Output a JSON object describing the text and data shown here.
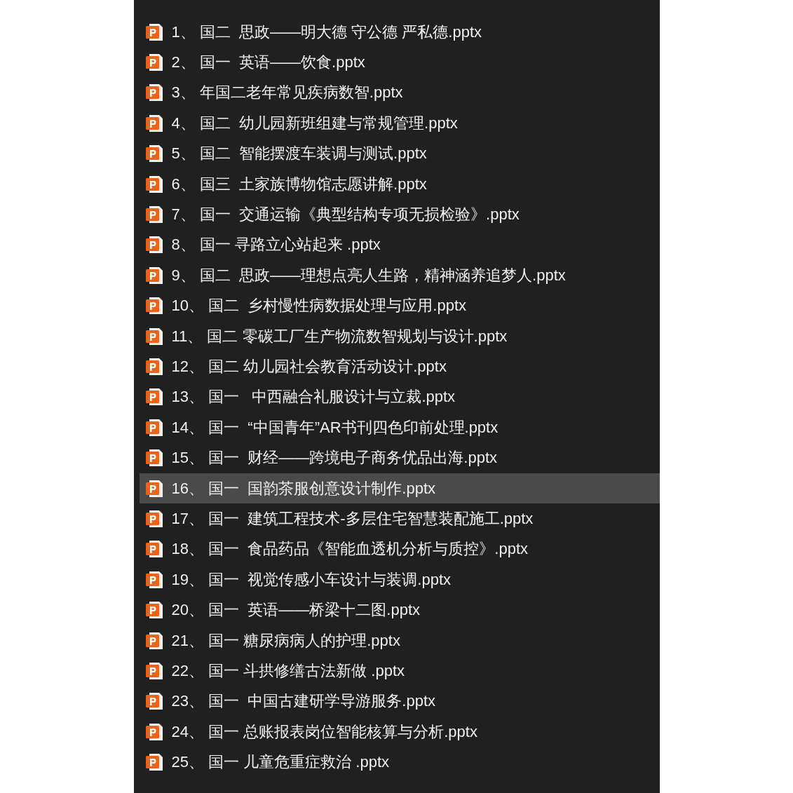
{
  "files": [
    {
      "name": "1、 国二  思政——明大德 守公德 严私德.pptx",
      "selected": false
    },
    {
      "name": "2、 国一  英语——饮食.pptx",
      "selected": false
    },
    {
      "name": "3、 年国二老年常见疾病数智.pptx",
      "selected": false
    },
    {
      "name": "4、 国二  幼儿园新班组建与常规管理.pptx",
      "selected": false
    },
    {
      "name": "5、 国二  智能摆渡车装调与测试.pptx",
      "selected": false
    },
    {
      "name": "6、 国三  土家族博物馆志愿讲解.pptx",
      "selected": false
    },
    {
      "name": "7、 国一  交通运输《典型结构专项无损检验》.pptx",
      "selected": false
    },
    {
      "name": "8、 国一 寻路立心站起来 .pptx",
      "selected": false
    },
    {
      "name": "9、 国二  思政——理想点亮人生路，精神涵养追梦人.pptx",
      "selected": false
    },
    {
      "name": "10、 国二  乡村慢性病数据处理与应用.pptx",
      "selected": false
    },
    {
      "name": "11、 国二 零碳工厂生产物流数智规划与设计.pptx",
      "selected": false
    },
    {
      "name": "12、 国二 幼儿园社会教育活动设计.pptx",
      "selected": false
    },
    {
      "name": "13、 国一   中西融合礼服设计与立裁.pptx",
      "selected": false
    },
    {
      "name": "14、 国一  “中国青年”AR书刊四色印前处理.pptx",
      "selected": false
    },
    {
      "name": "15、 国一  财经——跨境电子商务优品出海.pptx",
      "selected": false
    },
    {
      "name": "16、 国一  国韵茶服创意设计制作.pptx",
      "selected": true
    },
    {
      "name": "17、 国一  建筑工程技术-多层住宅智慧装配施工.pptx",
      "selected": false
    },
    {
      "name": "18、 国一  食品药品《智能血透机分析与质控》.pptx",
      "selected": false
    },
    {
      "name": "19、 国一  视觉传感小车设计与装调.pptx",
      "selected": false
    },
    {
      "name": "20、 国一  英语——桥梁十二图.pptx",
      "selected": false
    },
    {
      "name": "21、 国一 糖尿病病人的护理.pptx",
      "selected": false
    },
    {
      "name": "22、 国一 斗拱修缮古法新做 .pptx",
      "selected": false
    },
    {
      "name": "23、 国一  中国古建研学导游服务.pptx",
      "selected": false
    },
    {
      "name": "24、 国一 总账报表岗位智能核算与分析.pptx",
      "selected": false
    },
    {
      "name": "25、 国一 儿童危重症救治 .pptx",
      "selected": false
    }
  ]
}
